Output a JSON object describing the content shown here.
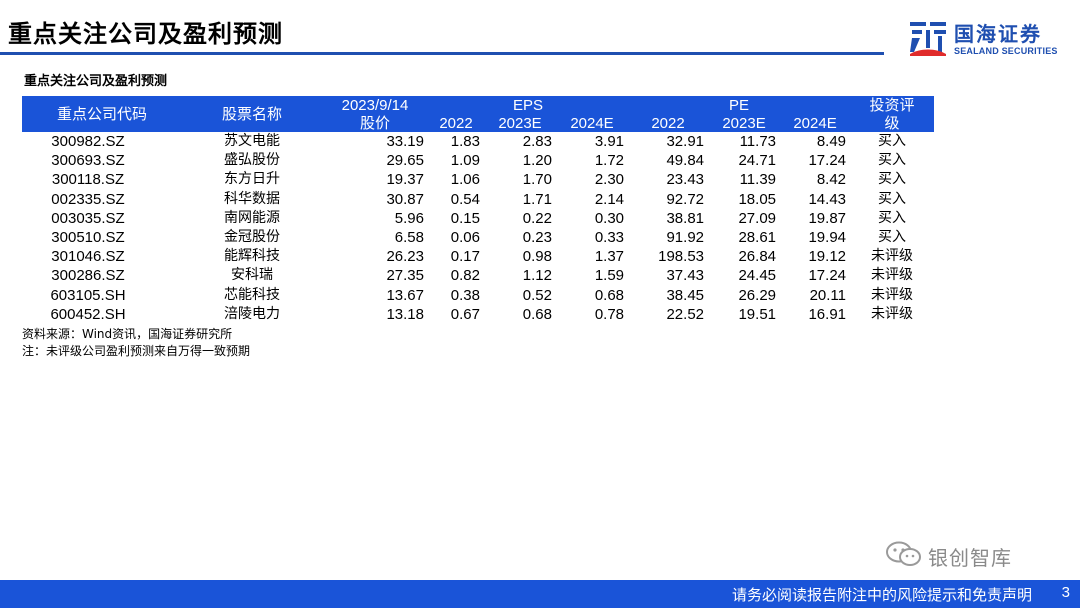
{
  "page": {
    "title": "重点关注公司及盈利预测",
    "logo_cn": "国海证券",
    "logo_en": "SEALAND SECURITIES",
    "table_caption": "重点关注公司及盈利预测",
    "source_note": "资料来源：Wind资讯，国海证券研究所",
    "footnote": "注：未评级公司盈利预测来自万得一致预期",
    "watermark": "银创智库",
    "footer_disclaimer": "请务必阅读报告附注中的风险提示和免责声明",
    "page_number": "3",
    "accent_color": "#1a54d8"
  },
  "table": {
    "header_top": {
      "code": "重点公司代码",
      "name": "股票名称",
      "price_date": "2023/9/14",
      "eps": "EPS",
      "pe": "PE",
      "rating_line1": "投资评"
    },
    "header_bottom": {
      "price": "股价",
      "eps_2022": "2022",
      "eps_2023e": "2023E",
      "eps_2024e": "2024E",
      "pe_2022": "2022",
      "pe_2023e": "2023E",
      "pe_2024e": "2024E",
      "rating_line2": "级"
    },
    "rows": [
      {
        "code": "300982.SZ",
        "name": "苏文电能",
        "price": "33.19",
        "eps_2022": "1.83",
        "eps_2023e": "2.83",
        "eps_2024e": "3.91",
        "pe_2022": "32.91",
        "pe_2023e": "11.73",
        "pe_2024e": "8.49",
        "rating": "买入"
      },
      {
        "code": "300693.SZ",
        "name": "盛弘股份",
        "price": "29.65",
        "eps_2022": "1.09",
        "eps_2023e": "1.20",
        "eps_2024e": "1.72",
        "pe_2022": "49.84",
        "pe_2023e": "24.71",
        "pe_2024e": "17.24",
        "rating": "买入"
      },
      {
        "code": "300118.SZ",
        "name": "东方日升",
        "price": "19.37",
        "eps_2022": "1.06",
        "eps_2023e": "1.70",
        "eps_2024e": "2.30",
        "pe_2022": "23.43",
        "pe_2023e": "11.39",
        "pe_2024e": "8.42",
        "rating": "买入"
      },
      {
        "code": "002335.SZ",
        "name": "科华数据",
        "price": "30.87",
        "eps_2022": "0.54",
        "eps_2023e": "1.71",
        "eps_2024e": "2.14",
        "pe_2022": "92.72",
        "pe_2023e": "18.05",
        "pe_2024e": "14.43",
        "rating": "买入"
      },
      {
        "code": "003035.SZ",
        "name": "南网能源",
        "price": "5.96",
        "eps_2022": "0.15",
        "eps_2023e": "0.22",
        "eps_2024e": "0.30",
        "pe_2022": "38.81",
        "pe_2023e": "27.09",
        "pe_2024e": "19.87",
        "rating": "买入"
      },
      {
        "code": "300510.SZ",
        "name": "金冠股份",
        "price": "6.58",
        "eps_2022": "0.06",
        "eps_2023e": "0.23",
        "eps_2024e": "0.33",
        "pe_2022": "91.92",
        "pe_2023e": "28.61",
        "pe_2024e": "19.94",
        "rating": "买入"
      },
      {
        "code": "301046.SZ",
        "name": "能辉科技",
        "price": "26.23",
        "eps_2022": "0.17",
        "eps_2023e": "0.98",
        "eps_2024e": "1.37",
        "pe_2022": "198.53",
        "pe_2023e": "26.84",
        "pe_2024e": "19.12",
        "rating": "未评级"
      },
      {
        "code": "300286.SZ",
        "name": "安科瑞",
        "price": "27.35",
        "eps_2022": "0.82",
        "eps_2023e": "1.12",
        "eps_2024e": "1.59",
        "pe_2022": "37.43",
        "pe_2023e": "24.45",
        "pe_2024e": "17.24",
        "rating": "未评级"
      },
      {
        "code": "603105.SH",
        "name": "芯能科技",
        "price": "13.67",
        "eps_2022": "0.38",
        "eps_2023e": "0.52",
        "eps_2024e": "0.68",
        "pe_2022": "38.45",
        "pe_2023e": "26.29",
        "pe_2024e": "20.11",
        "rating": "未评级"
      },
      {
        "code": "600452.SH",
        "name": "涪陵电力",
        "price": "13.18",
        "eps_2022": "0.67",
        "eps_2023e": "0.68",
        "eps_2024e": "0.78",
        "pe_2022": "22.52",
        "pe_2023e": "19.51",
        "pe_2024e": "16.91",
        "rating": "未评级"
      }
    ]
  }
}
